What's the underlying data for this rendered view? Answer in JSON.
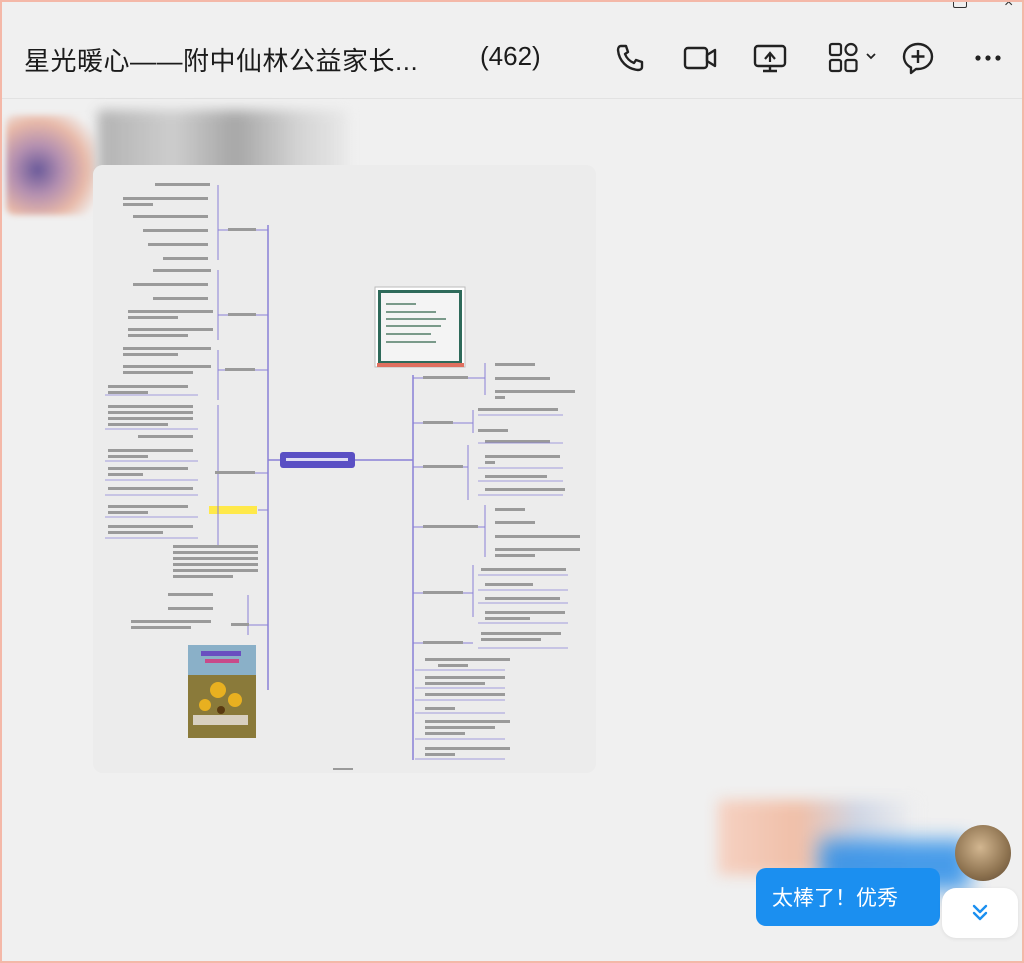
{
  "chat": {
    "title": "星光暖心——附中仙林公益家长...",
    "member_count": "(462)"
  },
  "header_icons": [
    "phone-icon",
    "video-icon",
    "screen-share-icon",
    "apps-icon",
    "add-member-icon",
    "more-icon"
  ],
  "message": {
    "image_caption": "",
    "reply_text": "太棒了！优秀"
  },
  "colors": {
    "accent": "#1b8ff0",
    "mindmap_root": "#5a4fc4",
    "branch_line": "#7b6fd0",
    "highlight": "#ffe94a"
  }
}
